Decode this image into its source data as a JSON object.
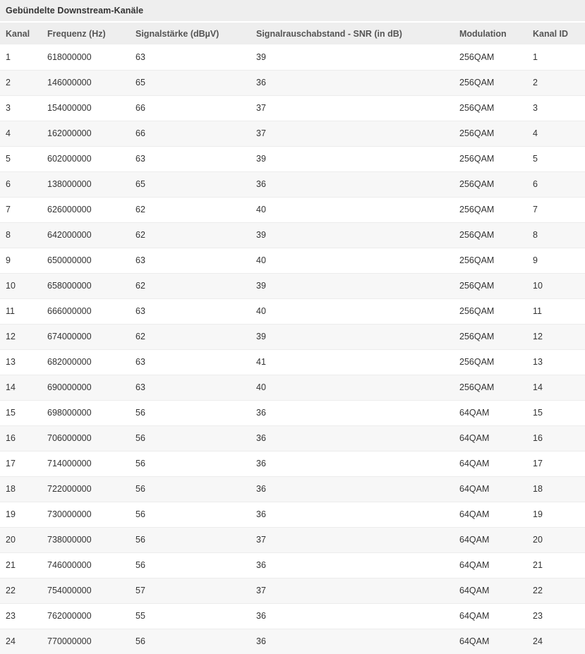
{
  "panel": {
    "title": "Gebündelte Downstream-Kanäle"
  },
  "table": {
    "columns": [
      {
        "key": "kanal",
        "label": "Kanal"
      },
      {
        "key": "frequenz",
        "label": "Frequenz (Hz)"
      },
      {
        "key": "signal",
        "label": "Signalstärke (dBµV)"
      },
      {
        "key": "snr",
        "label": "Signalrauschabstand - SNR (in dB)"
      },
      {
        "key": "modulation",
        "label": "Modulation"
      },
      {
        "key": "kanal_id",
        "label": "Kanal ID"
      }
    ],
    "rows": [
      {
        "kanal": "1",
        "frequenz": "618000000",
        "signal": "63",
        "snr": "39",
        "modulation": "256QAM",
        "kanal_id": "1"
      },
      {
        "kanal": "2",
        "frequenz": "146000000",
        "signal": "65",
        "snr": "36",
        "modulation": "256QAM",
        "kanal_id": "2"
      },
      {
        "kanal": "3",
        "frequenz": "154000000",
        "signal": "66",
        "snr": "37",
        "modulation": "256QAM",
        "kanal_id": "3"
      },
      {
        "kanal": "4",
        "frequenz": "162000000",
        "signal": "66",
        "snr": "37",
        "modulation": "256QAM",
        "kanal_id": "4"
      },
      {
        "kanal": "5",
        "frequenz": "602000000",
        "signal": "63",
        "snr": "39",
        "modulation": "256QAM",
        "kanal_id": "5"
      },
      {
        "kanal": "6",
        "frequenz": "138000000",
        "signal": "65",
        "snr": "36",
        "modulation": "256QAM",
        "kanal_id": "6"
      },
      {
        "kanal": "7",
        "frequenz": "626000000",
        "signal": "62",
        "snr": "40",
        "modulation": "256QAM",
        "kanal_id": "7"
      },
      {
        "kanal": "8",
        "frequenz": "642000000",
        "signal": "62",
        "snr": "39",
        "modulation": "256QAM",
        "kanal_id": "8"
      },
      {
        "kanal": "9",
        "frequenz": "650000000",
        "signal": "63",
        "snr": "40",
        "modulation": "256QAM",
        "kanal_id": "9"
      },
      {
        "kanal": "10",
        "frequenz": "658000000",
        "signal": "62",
        "snr": "39",
        "modulation": "256QAM",
        "kanal_id": "10"
      },
      {
        "kanal": "11",
        "frequenz": "666000000",
        "signal": "63",
        "snr": "40",
        "modulation": "256QAM",
        "kanal_id": "11"
      },
      {
        "kanal": "12",
        "frequenz": "674000000",
        "signal": "62",
        "snr": "39",
        "modulation": "256QAM",
        "kanal_id": "12"
      },
      {
        "kanal": "13",
        "frequenz": "682000000",
        "signal": "63",
        "snr": "41",
        "modulation": "256QAM",
        "kanal_id": "13"
      },
      {
        "kanal": "14",
        "frequenz": "690000000",
        "signal": "63",
        "snr": "40",
        "modulation": "256QAM",
        "kanal_id": "14"
      },
      {
        "kanal": "15",
        "frequenz": "698000000",
        "signal": "56",
        "snr": "36",
        "modulation": "64QAM",
        "kanal_id": "15"
      },
      {
        "kanal": "16",
        "frequenz": "706000000",
        "signal": "56",
        "snr": "36",
        "modulation": "64QAM",
        "kanal_id": "16"
      },
      {
        "kanal": "17",
        "frequenz": "714000000",
        "signal": "56",
        "snr": "36",
        "modulation": "64QAM",
        "kanal_id": "17"
      },
      {
        "kanal": "18",
        "frequenz": "722000000",
        "signal": "56",
        "snr": "36",
        "modulation": "64QAM",
        "kanal_id": "18"
      },
      {
        "kanal": "19",
        "frequenz": "730000000",
        "signal": "56",
        "snr": "36",
        "modulation": "64QAM",
        "kanal_id": "19"
      },
      {
        "kanal": "20",
        "frequenz": "738000000",
        "signal": "56",
        "snr": "37",
        "modulation": "64QAM",
        "kanal_id": "20"
      },
      {
        "kanal": "21",
        "frequenz": "746000000",
        "signal": "56",
        "snr": "36",
        "modulation": "64QAM",
        "kanal_id": "21"
      },
      {
        "kanal": "22",
        "frequenz": "754000000",
        "signal": "57",
        "snr": "37",
        "modulation": "64QAM",
        "kanal_id": "22"
      },
      {
        "kanal": "23",
        "frequenz": "762000000",
        "signal": "55",
        "snr": "36",
        "modulation": "64QAM",
        "kanal_id": "23"
      },
      {
        "kanal": "24",
        "frequenz": "770000000",
        "signal": "56",
        "snr": "36",
        "modulation": "64QAM",
        "kanal_id": "24"
      }
    ]
  },
  "colors": {
    "header_bg": "#eeeeee",
    "row_alt_bg": "#f7f7f7",
    "row_bg": "#ffffff",
    "text": "#333333",
    "header_text": "#555555"
  }
}
